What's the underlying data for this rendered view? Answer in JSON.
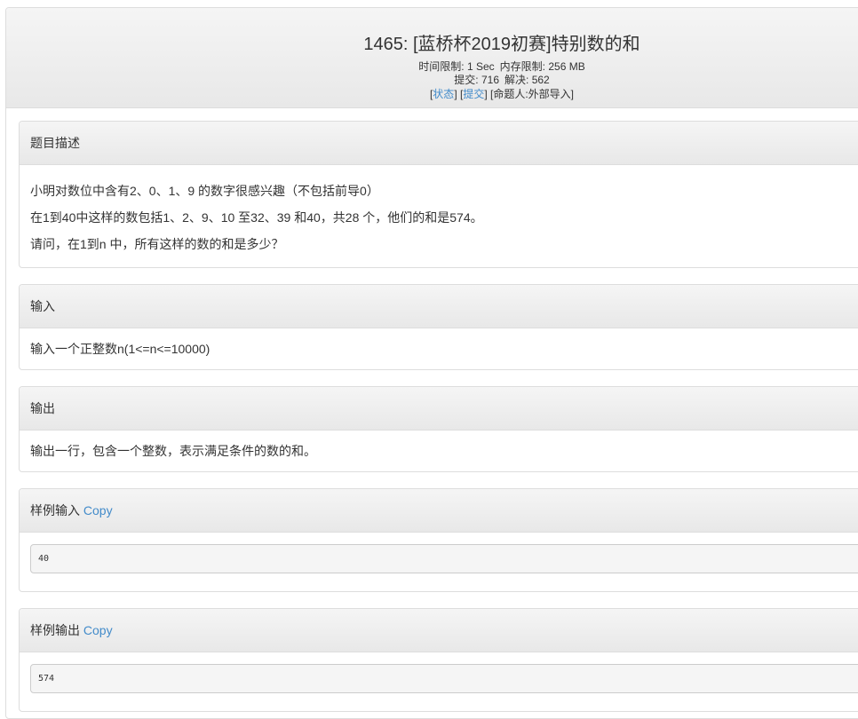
{
  "header": {
    "title": "1465: [蓝桥杯2019初赛]特别数的和",
    "time_limit_label": "时间限制:",
    "time_limit_value": "1 Sec",
    "memory_limit_label": "内存限制:",
    "memory_limit_value": "256 MB",
    "submit_label": "提交:",
    "submit_value": "716",
    "solved_label": "解决:",
    "solved_value": "562",
    "status_link": "状态",
    "submit_link": "提交",
    "author": "[命题人:外部导入]"
  },
  "description": {
    "heading": "题目描述",
    "lines": [
      "小明对数位中含有2、0、1、9 的数字很感兴趣（不包括前导0）",
      "在1到40中这样的数包括1、2、9、10 至32、39 和40，共28 个，他们的和是574。",
      "请问，在1到n 中，所有这样的数的和是多少？"
    ]
  },
  "input": {
    "heading": "输入",
    "body": "输入一个正整数n(1<=n<=10000)"
  },
  "output": {
    "heading": "输出",
    "body": "输出一行，包含一个整数，表示满足条件的数的和。"
  },
  "sample_input": {
    "heading": "样例输入",
    "copy_label": "Copy",
    "value": "40"
  },
  "sample_output": {
    "heading": "样例输出",
    "copy_label": "Copy",
    "value": "574"
  }
}
